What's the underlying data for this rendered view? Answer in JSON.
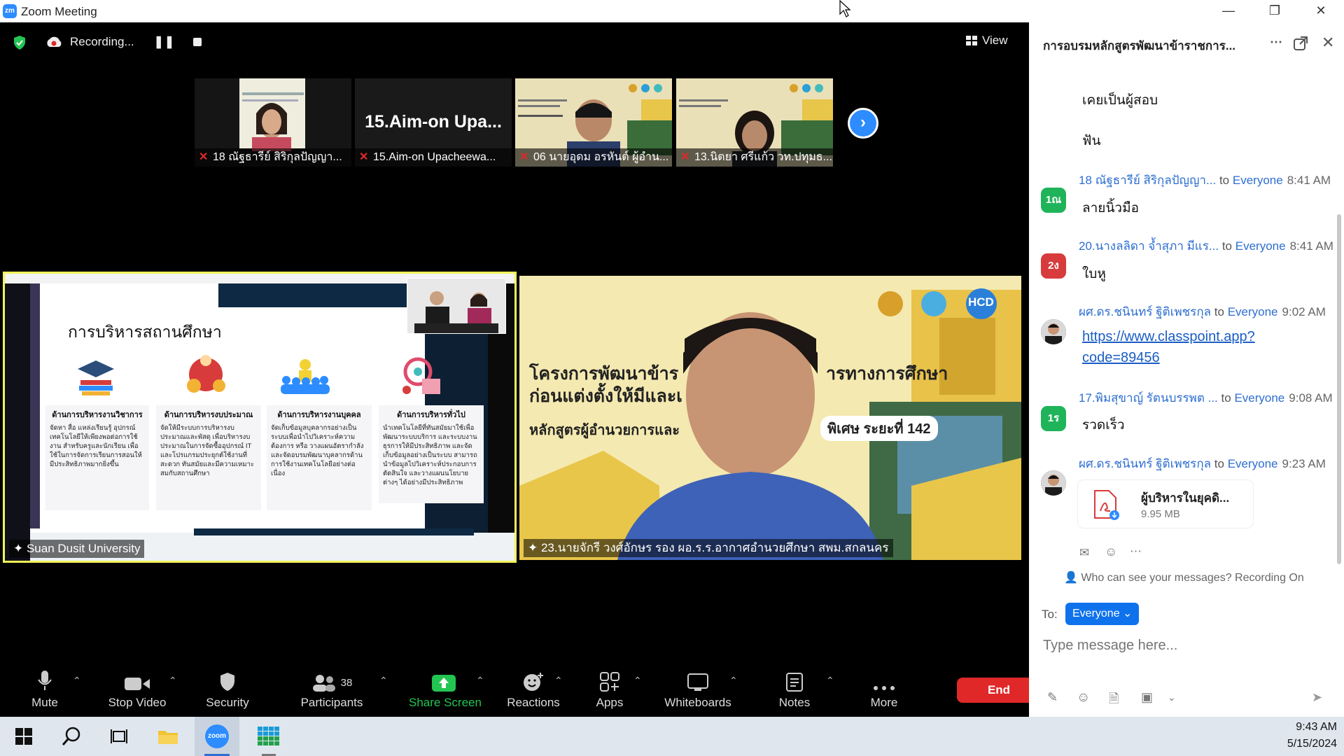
{
  "window": {
    "title": "Zoom Meeting",
    "app_icon_text": "zm"
  },
  "top_bar": {
    "recording_label": "Recording...",
    "view_label": "View"
  },
  "thumbnails": [
    {
      "name": "18 ณัฐธารีย์ สิริกุลปัญญา...",
      "muted": true
    },
    {
      "name": "15.Aim-on Upacheewa...",
      "display_name": "15.Aim-on Upa...",
      "muted": true
    },
    {
      "name": "06 นายอุดม อรหันต์ ผู้อำน...",
      "muted": true
    },
    {
      "name": "13.นิตยา ศรีแก้ว วท.ปทุมธ...",
      "muted": true
    }
  ],
  "main_videos": {
    "left_label": "Suan Dusit University",
    "right_label": "23.นายจักรี วงศ์อักษร รอง ผอ.ร.ร.อากาศอำนวยศึกษา สพม.สกลนคร",
    "slide": {
      "title": "การบริหารสถานศึกษา",
      "columns": [
        {
          "heading": "ด้านการบริหารงานวิชาการ",
          "body": "จัดหา สื่อ แหล่งเรียนรู้ อุปกรณ์เทคโนโลยีให้เพียงพอต่อการใช้งาน สำหรับครูและนักเรียน เพื่อใช้ในการจัดการเรียนการสอนให้มีประสิทธิภาพมากยิ่งขึ้น"
        },
        {
          "heading": "ด้านการบริหารงบประมาณ",
          "body": "จัดให้มีระบบการบริหารงบประมาณและพัสดุ เพื่อบริหารงบประมาณในการจัดซื้ออุปกรณ์ IT และโปรแกรมประยุกต์ใช้งานที่สะดวก ทันสมัยและมีความเหมาะสมกับสถานศึกษา"
        },
        {
          "heading": "ด้านการบริหารงานบุคคล",
          "body": "จัดเก็บข้อมูลบุคลากรอย่างเป็นระบบเพื่อนำไปวิเคราะห์ความต้องการ หรือ วางแผนอัตรากำลัง และจัดอบรมพัฒนาบุคลากรด้านการใช้งานเทคโนโลยีอย่างต่อเนื่อง"
        },
        {
          "heading": "ด้านการบริหารทั่วไป",
          "body": "นำเทคโนโลยีที่ทันสมัยมาใช้เพื่อพัฒนาระบบบริการ และระบบงานธุรการให้มีประสิทธิภาพ และจัดเก็บข้อมูลอย่างเป็นระบบ สามารถนำข้อมูลไปวิเคราะห์ประกอบการตัดสินใจ และวางแผนนโยบายต่างๆ ได้อย่างมีประสิทธิภาพ"
        }
      ]
    },
    "banner": {
      "line1": "โครงการพัฒนาข้าร",
      "line1b": "ารทางการศึกษา",
      "line2": "ก่อนแต่งตั้งให้มีและเ",
      "line3": "หลักสูตรผู้อำนวยการและ",
      "line3b": "พิเศษ ระยะที่ 142",
      "badge": "HCD"
    }
  },
  "toolbar": {
    "mute": "Mute",
    "stop_video": "Stop Video",
    "security": "Security",
    "participants": "Participants",
    "participants_count": "38",
    "share_screen": "Share Screen",
    "reactions": "Reactions",
    "apps": "Apps",
    "whiteboards": "Whiteboards",
    "notes": "Notes",
    "more": "More",
    "end": "End"
  },
  "chat": {
    "title": "การอบรมหลักสูตรพัฒนาข้าราชการ...",
    "messages": [
      {
        "text": "เคยเป็นผู้สอบ"
      },
      {
        "text": "ฟัน"
      },
      {
        "sender": "18 ณัฐธารีย์ สิริกุลปัญญา...",
        "to": "to",
        "recipient": "Everyone",
        "time": "8:41 AM",
        "avatar": "1ณ",
        "avatar_color": "#1fb45a",
        "text": "ลายนิ้วมือ"
      },
      {
        "sender": "20.นางลลิดา จ้ำสุภา มีแร...",
        "to": "to",
        "recipient": "Everyone",
        "time": "8:41 AM",
        "avatar": "2ง",
        "avatar_color": "#d83b3b",
        "text": "ใบหู"
      },
      {
        "sender": "ผศ.ดร.ชนินทร์ ฐิติเพชรกุล",
        "to": "to",
        "recipient": "Everyone",
        "time": "9:02 AM",
        "link": "https://www.classpoint.app?code=89456",
        "link_line1": "https://www.classpoint.app?",
        "link_line2": "code=89456"
      },
      {
        "sender": "17.พิมสุขาญ์ รัตนบรรพต ...",
        "to": "to",
        "recipient": "Everyone",
        "time": "9:08 AM",
        "avatar": "1ร",
        "avatar_color": "#1fb45a",
        "text": "รวดเร็ว"
      },
      {
        "sender": "ผศ.ดร.ชนินทร์ ฐิติเพชรกุล",
        "to": "to",
        "recipient": "Everyone",
        "time": "9:23 AM",
        "file_name": "ผู้บริหารในยุคดิ...",
        "file_size": "9.95 MB"
      }
    ],
    "visibility_note": "Who can see your messages? Recording On",
    "to_label": "To:",
    "recipient_select": "Everyone",
    "input_placeholder": "Type message here..."
  },
  "taskbar": {
    "time": "9:43 AM",
    "date": "5/15/2024"
  },
  "colors": {
    "zoom_blue": "#2d8cff",
    "end_red": "#e02828",
    "share_green": "#23c552",
    "active_speaker": "#f2f25a"
  }
}
